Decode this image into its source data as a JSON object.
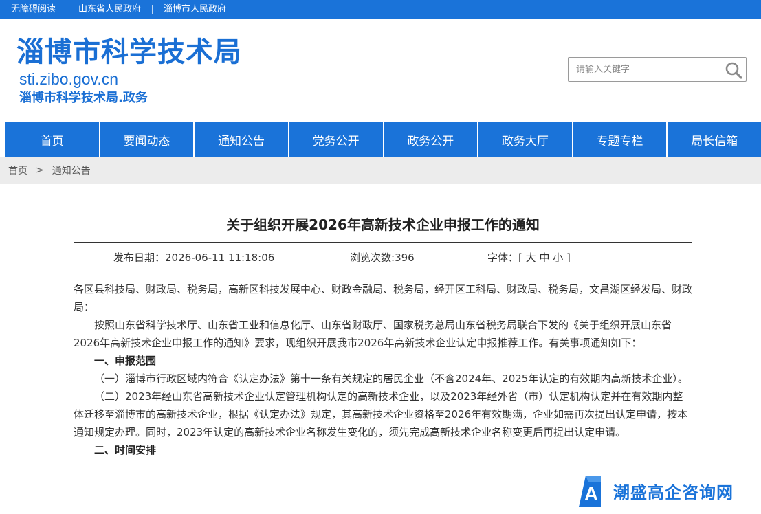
{
  "topbar": {
    "links": [
      "无障碍阅读",
      "山东省人民政府",
      "淄博市人民政府"
    ]
  },
  "header": {
    "title": "淄博市科学技术局",
    "domain": "sti.zibo.gov.cn",
    "subtitle": "淄博市科学技术局.政务"
  },
  "search": {
    "placeholder": "请输入关键字",
    "icon": "search-icon"
  },
  "nav": {
    "items": [
      "首页",
      "要闻动态",
      "通知公告",
      "党务公开",
      "政务公开",
      "政务大厅",
      "专题专栏",
      "局长信箱"
    ]
  },
  "breadcrumb": {
    "home": "首页",
    "separator": ">",
    "current": "通知公告"
  },
  "article": {
    "title": "关于组织开展2026年高新技术企业申报工作的通知",
    "date_label": "发布日期：",
    "date": "2026-06-11 11:18:06",
    "views_label": "浏览次数:",
    "views": "396",
    "font_label": "字体：[",
    "font_large": "大",
    "font_medium": "中",
    "font_small": "小",
    "font_close": "]",
    "recipients": "各区县科技局、财政局、税务局，高新区科技发展中心、财政金融局、税务局，经开区工科局、财政局、税务局，文昌湖区经发局、财政局：",
    "intro": "按照山东省科学技术厅、山东省工业和信息化厅、山东省财政厅、国家税务总局山东省税务局联合下发的《关于组织开展山东省2026年高新技术企业申报工作的通知》要求，现组织开展我市2026年高新技术企业认定申报推荐工作。有关事项通知如下：",
    "section1_heading": "一、申报范围",
    "section1_item1": "（一）淄博市行政区域内符合《认定办法》第十一条有关规定的居民企业（不含2024年、2025年认定的有效期内高新技术企业）。",
    "section1_item2": "（二）2023年经山东省高新技术企业认定管理机构认定的高新技术企业，以及2023年经外省（市）认定机构认定并在有效期内整体迁移至淄博市的高新技术企业，根据《认定办法》规定，其高新技术企业资格至2026年有效期满，企业如需再次提出认定申请，按本通知规定办理。同时，2023年认定的高新技术企业名称发生变化的，须先完成高新技术企业名称变更后再提出认定申请。",
    "section2_heading": "二、时间安排"
  },
  "watermark": {
    "text": "潮盛高企咨询网",
    "logo_letter": "A"
  },
  "colors": {
    "brand_blue": "#1a73d9",
    "title_blue": "#1a6fd4",
    "breadcrumb_bg": "#ececec"
  }
}
